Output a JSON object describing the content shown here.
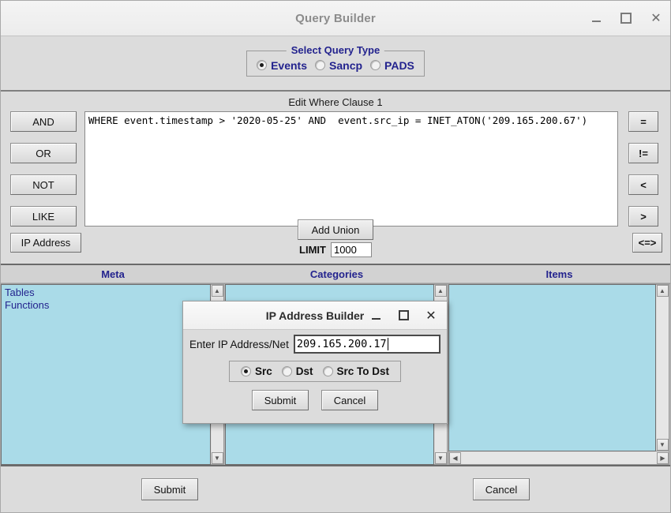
{
  "window": {
    "title": "Query Builder",
    "controls": {
      "minimize": "–",
      "maximize": "□",
      "close": "✕"
    }
  },
  "query_type": {
    "legend": "Select Query Type",
    "options": [
      {
        "label": "Events",
        "selected": true
      },
      {
        "label": "Sancp",
        "selected": false
      },
      {
        "label": "PADS",
        "selected": false
      }
    ]
  },
  "where_clause": {
    "heading": "Edit Where Clause 1",
    "text": "WHERE event.timestamp > '2020-05-25' AND  event.src_ip = INET_ATON('209.165.200.67')",
    "left_buttons": [
      "AND",
      "OR",
      "NOT",
      "LIKE"
    ],
    "ip_address_button": "IP Address",
    "operator_buttons": [
      "=",
      "!=",
      "<",
      ">"
    ],
    "operator_button_low": "<=>",
    "add_union_button": "Add Union",
    "limit_label": "LIMIT",
    "limit_value": "1000"
  },
  "browser": {
    "columns": [
      "Meta",
      "Categories",
      "Items"
    ],
    "meta_items": [
      "Tables",
      "Functions"
    ],
    "categories_items": [],
    "items_items": []
  },
  "footer": {
    "submit": "Submit",
    "cancel": "Cancel"
  },
  "dialog": {
    "title": "IP Address Builder",
    "controls": {
      "minimize": "–",
      "maximize": "□",
      "close": "✕"
    },
    "field_label": "Enter IP Address/Net",
    "field_value": "209.165.200.17",
    "field_placeholder": "",
    "radios": [
      {
        "label": "Src",
        "selected": true
      },
      {
        "label": "Dst",
        "selected": false
      },
      {
        "label": "Src To Dst",
        "selected": false
      }
    ],
    "submit": "Submit",
    "cancel": "Cancel"
  },
  "colors": {
    "listbox_bg": "#aadbe8",
    "label_blue": "#23238e",
    "window_bg": "#dcdcdc"
  },
  "scroll_icons": {
    "up": "▲",
    "down": "▼",
    "left": "◀",
    "right": "▶"
  }
}
